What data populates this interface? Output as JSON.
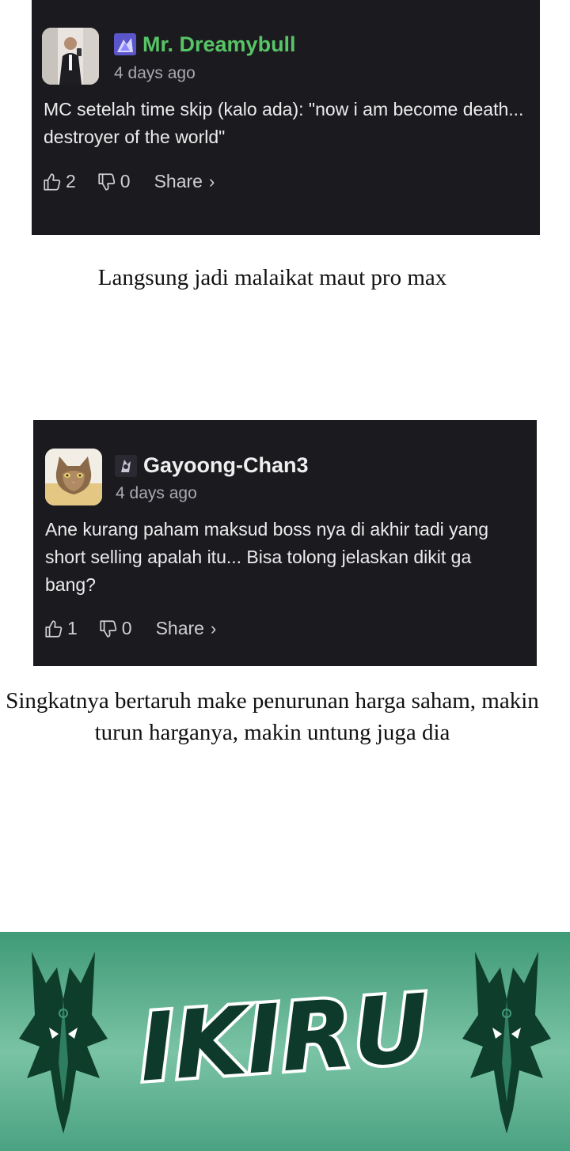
{
  "comments": [
    {
      "username": "Mr. Dreamybull",
      "username_color": "#57c466",
      "timestamp": "4 days ago",
      "text": "MC setelah time skip (kalo ada): \"now i am become death... destroyer of the world\"",
      "likes": "2",
      "dislikes": "0",
      "share_label": "Share",
      "share_chevron": "›"
    },
    {
      "username": "Gayoong-Chan3",
      "username_color": "#efefef",
      "timestamp": "4 days ago",
      "text": "Ane kurang paham maksud boss nya di akhir tadi yang short selling apalah itu... Bisa tolong jelaskan dikit ga bang?",
      "likes": "1",
      "dislikes": "0",
      "share_label": "Share",
      "share_chevron": "›"
    }
  ],
  "captions": [
    "Langsung jadi malaikat maut pro max",
    "Singkatnya bertaruh make penurunan harga saham, makin turun harganya, makin untung juga dia"
  ],
  "banner": {
    "logo_text": "IKIRU",
    "colors": {
      "background": "#5fb38f",
      "logo": "#0d3a2a"
    }
  },
  "icons": {
    "like": "thumbs-up-icon",
    "dislike": "thumbs-down-icon"
  }
}
